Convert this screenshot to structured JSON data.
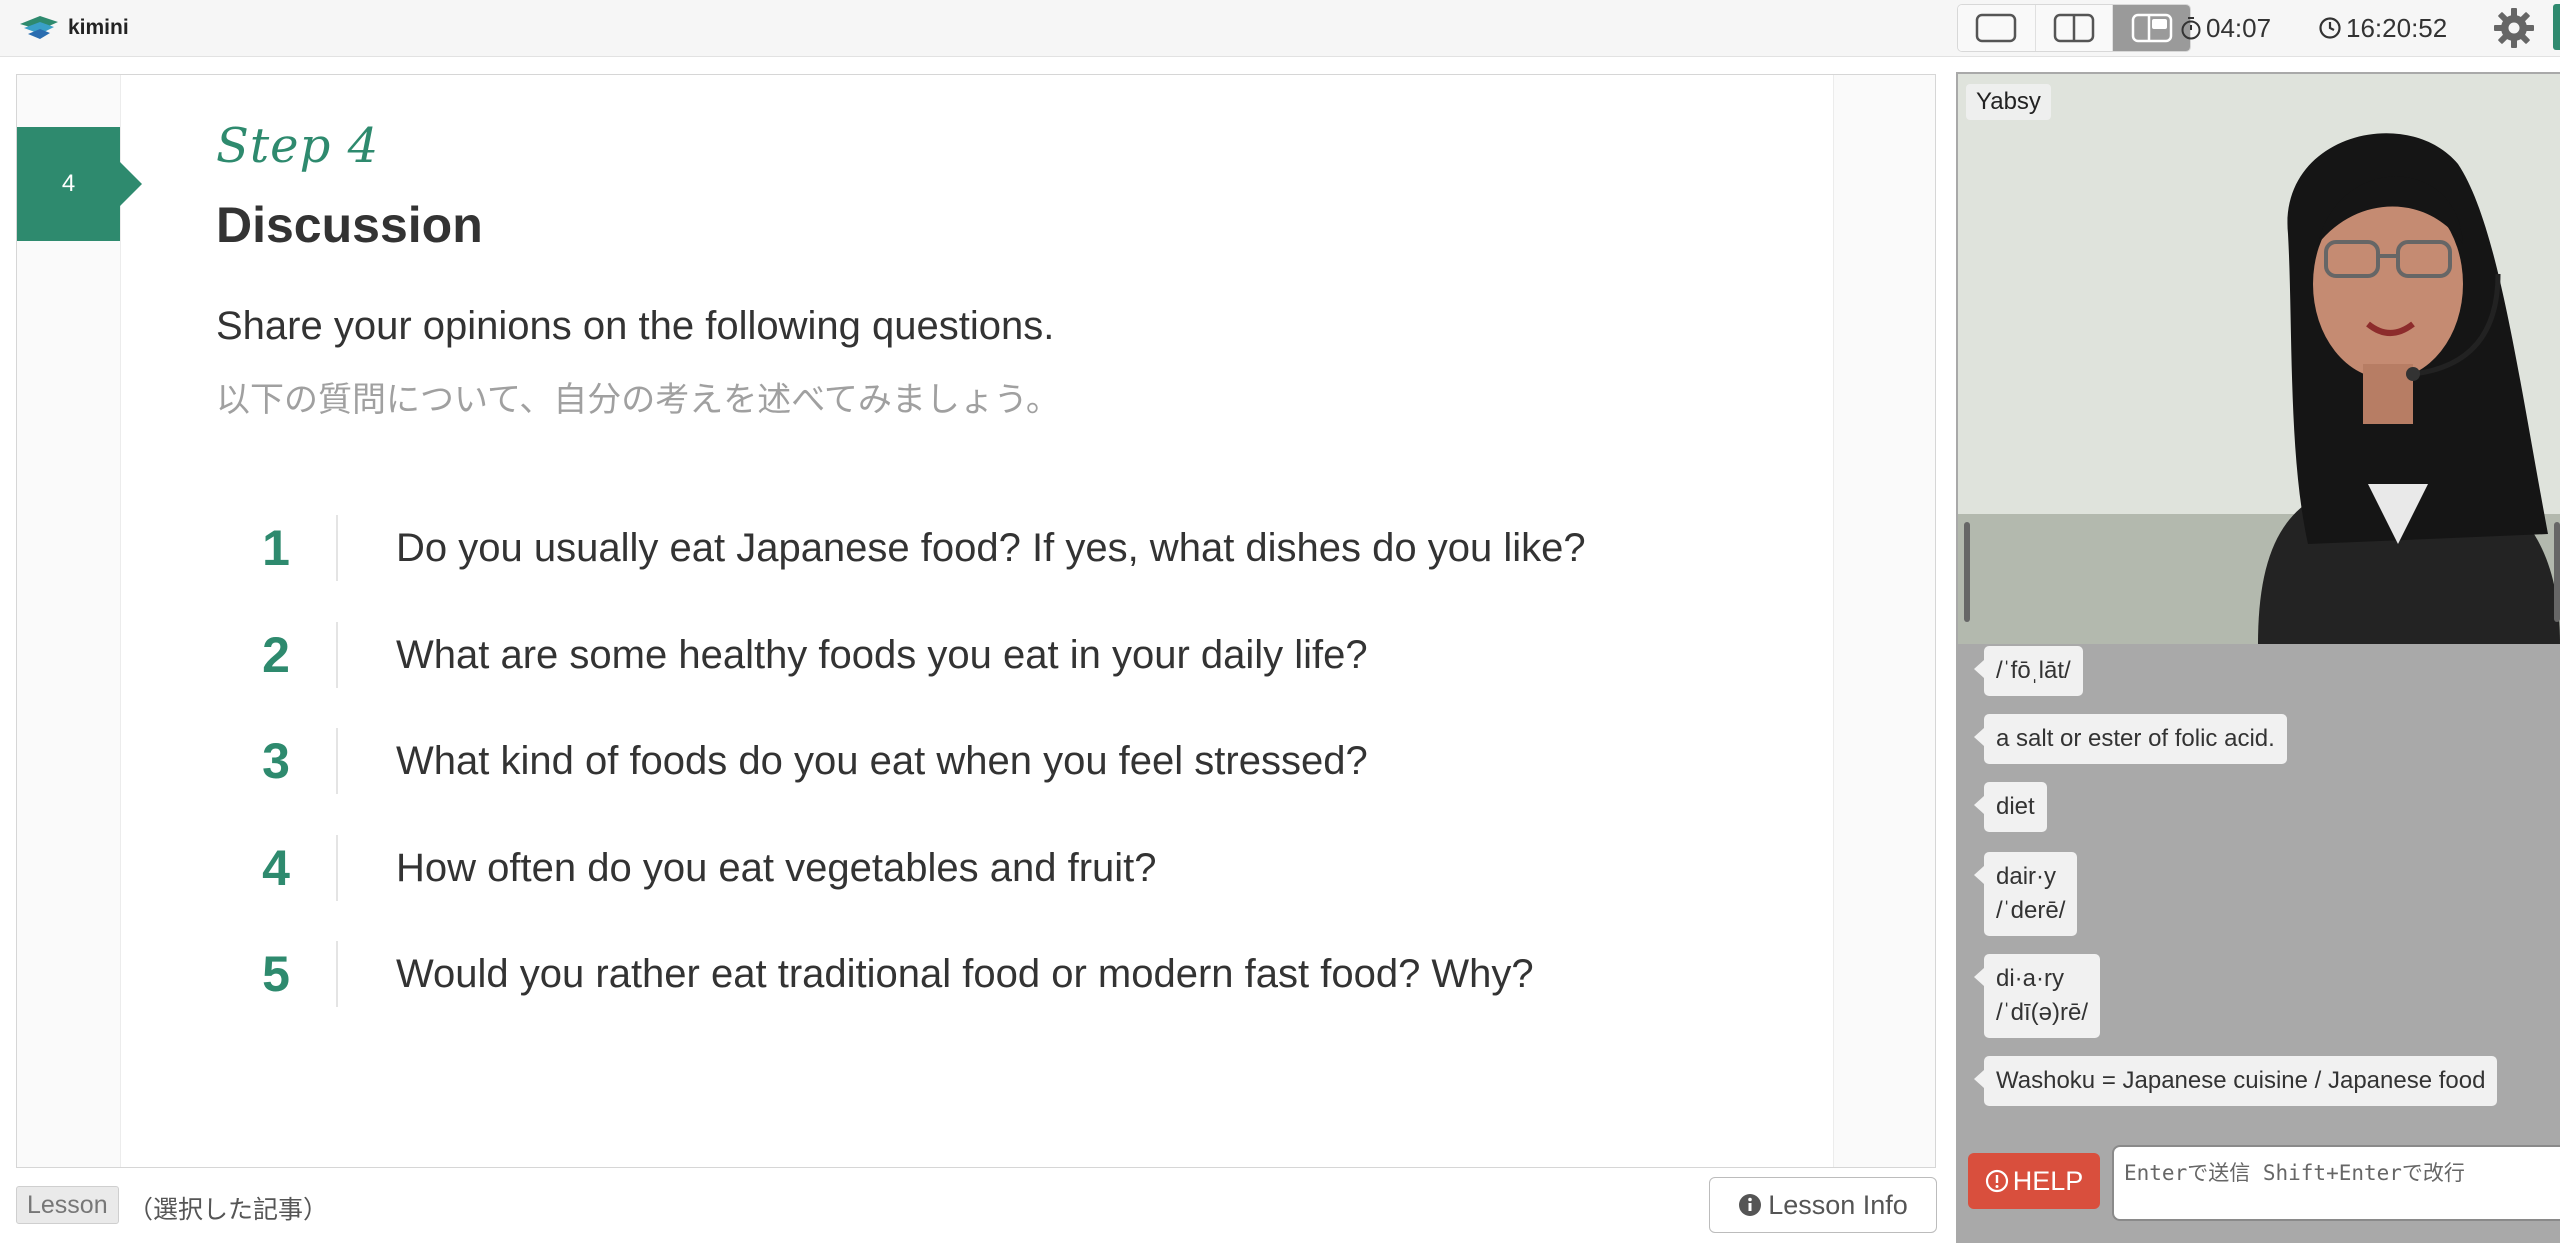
{
  "app": {
    "name": "kimini"
  },
  "topbar": {
    "layout_buttons": [
      "single-view",
      "split-view",
      "picture-in-picture-view"
    ],
    "active_layout": "picture-in-picture-view",
    "timer": "04:07",
    "clock": "16:20:52"
  },
  "slide": {
    "step_number": "4",
    "step_label": "Step 4",
    "title": "Discussion",
    "instruction_en": "Share your opinions on the following questions.",
    "instruction_jp": "以下の質問について、自分の考えを述べてみましょう。",
    "questions": [
      {
        "number": "1",
        "text": "Do you usually eat Japanese food? If yes, what dishes do you like?"
      },
      {
        "number": "2",
        "text": "What are some healthy foods you eat in your daily life?"
      },
      {
        "number": "3",
        "text": "What kind of foods do you eat when you feel stressed?"
      },
      {
        "number": "4",
        "text": "How often do you eat vegetables and fruit?"
      },
      {
        "number": "5",
        "text": "Would you rather eat traditional food or modern fast food? Why?"
      }
    ]
  },
  "footer": {
    "lesson_tag": "Lesson",
    "article_label": "（選択した記事）",
    "lesson_info_label": "Lesson Info"
  },
  "video": {
    "participant_name": "Yabsy"
  },
  "chat": {
    "messages": [
      {
        "text": "/ˈfōˌlāt/"
      },
      {
        "text": "a salt or ester of folic acid."
      },
      {
        "text": "diet"
      },
      {
        "line1": "dair·y",
        "line2": "/ˈderē/"
      },
      {
        "line1": "di·a·ry",
        "line2": "/ˈdī(ə)rē/"
      },
      {
        "text": "Washoku = Japanese cuisine / Japanese food"
      }
    ],
    "help_label": "HELP",
    "input_placeholder": "Enterで送信 Shift+Enterで改行"
  },
  "colors": {
    "accent": "#2e8a6e",
    "help": "#d94f3d",
    "chat_bg": "#a9a9a9"
  }
}
